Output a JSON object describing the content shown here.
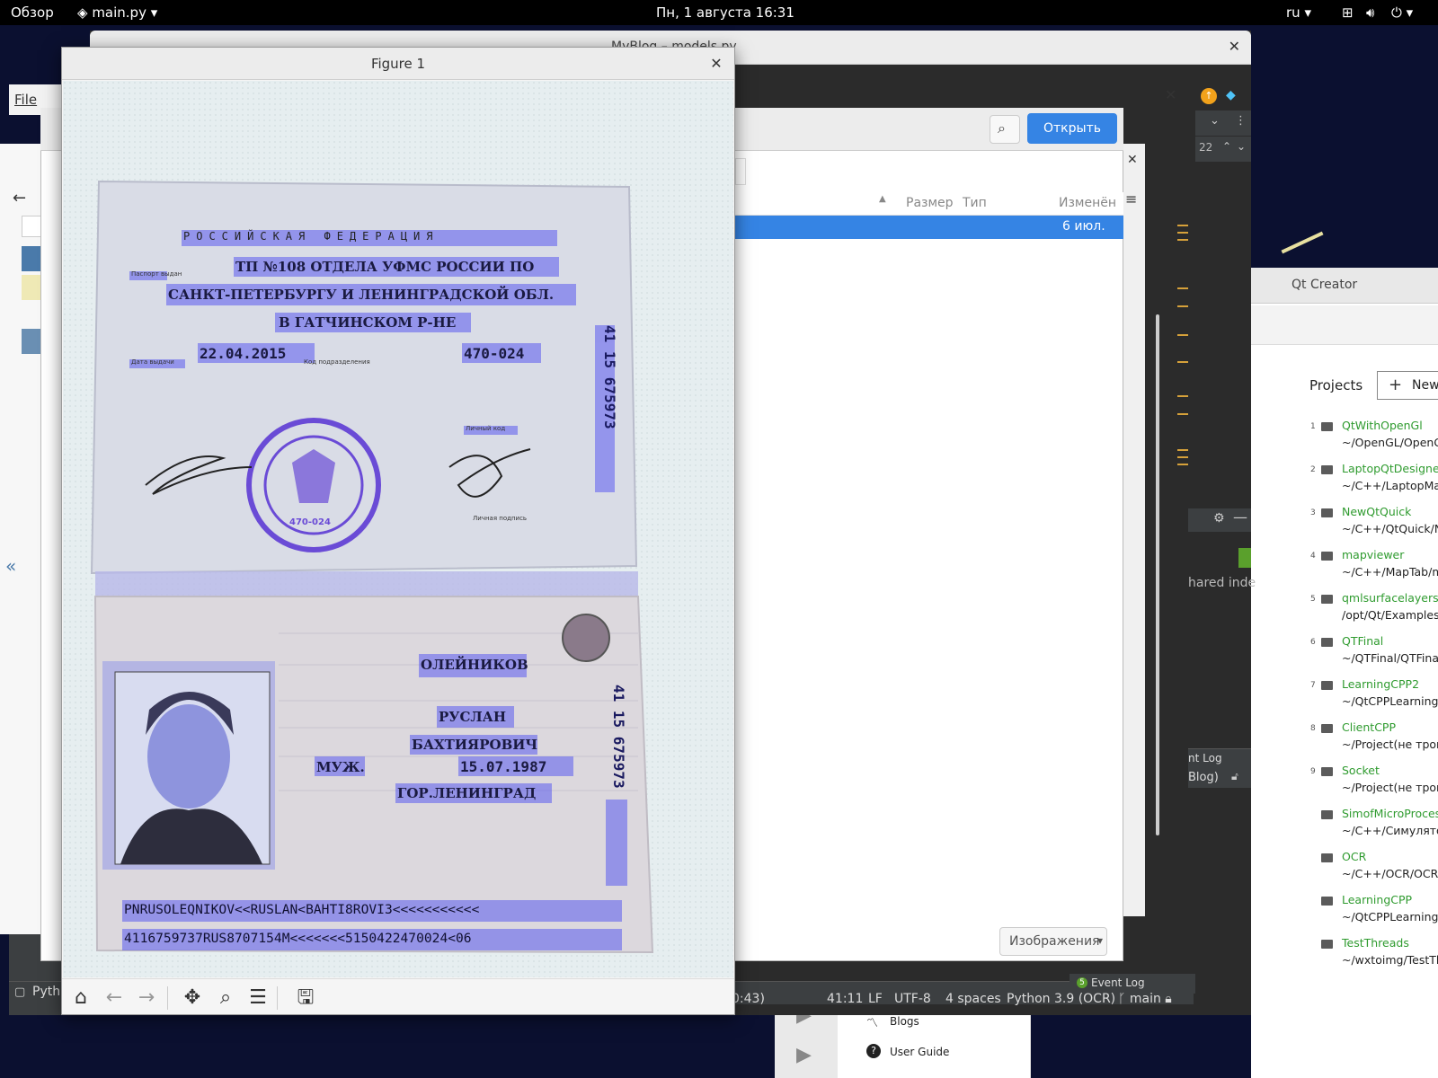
{
  "topbar": {
    "overview": "Обзор",
    "app_menu": "main.py",
    "clock": "Пн, 1 августа  16:31",
    "lang": "ru"
  },
  "back_window": {
    "title": "MyBlog – models.py"
  },
  "file_dialog": {
    "open_label": "Открыть",
    "col_size": "Размер",
    "col_type": "Тип",
    "col_modified": "Изменён",
    "selected_row_modified": "6 июл.",
    "filter_label": "Изображения"
  },
  "ide": {
    "menu_file": "File",
    "status": {
      "time": "0:43)",
      "position": "41:11",
      "line_sep": "LF",
      "encoding": "UTF-8",
      "indent": "4 spaces",
      "interpreter": "Python 3.9 (OCR)",
      "branch": "main",
      "event_log": "Event Log",
      "event_count": "5",
      "python_tab": "Pyth"
    },
    "side_text": "hared inde",
    "event_log_tab": "nt Log",
    "blog_tab": "Blog)",
    "line_number": "22"
  },
  "qt": {
    "title": "Qt Creator",
    "projects_label": "Projects",
    "new_label": "New",
    "projects": [
      {
        "num": "1",
        "name": "QtWithOpenGl",
        "path": "~/OpenGL/OpenGl"
      },
      {
        "num": "2",
        "name": "LaptopQtDesigner",
        "path": "~/C++/LaptopMap"
      },
      {
        "num": "3",
        "name": "NewQtQuick",
        "path": "~/C++/QtQuick/Ne"
      },
      {
        "num": "4",
        "name": "mapviewer",
        "path": "~/C++/MapTab/ma"
      },
      {
        "num": "5",
        "name": "qmlsurfacelayers",
        "path": "/opt/Qt/Examples/"
      },
      {
        "num": "6",
        "name": "QTFinal",
        "path": "~/QTFinal/QTFina"
      },
      {
        "num": "7",
        "name": "LearningCPP2",
        "path": "~/QtCPPLearning/"
      },
      {
        "num": "8",
        "name": "ClientCPP",
        "path": "~/Project(не трога"
      },
      {
        "num": "9",
        "name": "Socket",
        "path": "~/Project(не трога"
      },
      {
        "num": "",
        "name": "SimofMicroProces",
        "path": "~/C++/Симулятор"
      },
      {
        "num": "",
        "name": "OCR",
        "path": "~/C++/OCR/OCR/"
      },
      {
        "num": "",
        "name": "LearningCPP",
        "path": "~/QtCPPLearning/"
      },
      {
        "num": "",
        "name": "TestThreads",
        "path": "~/wxtoimg/TestTh"
      }
    ],
    "bottom_links": [
      {
        "label": "Blogs",
        "icon": "rss-icon"
      },
      {
        "label": "User Guide",
        "icon": "help-icon"
      }
    ]
  },
  "figure": {
    "title": "Figure 1",
    "passport": {
      "header": "РОССИЙСКАЯ   ФЕДЕРАЦИЯ",
      "issuer_1": "ТП №108 ОТДЕЛА УФМС РОССИИ ПО",
      "issuer_2": "САНКТ-ПЕТЕРБУРГУ И ЛЕНИНГРАДСКОЙ ОБЛ.",
      "issuer_3": "В ГАТЧИНСКОМ Р-НЕ",
      "issue_date": "22.04.2015",
      "dept_code": "470-024",
      "serial_top": "41  15  675973",
      "stamp_code": "470-024",
      "surname": "ОЛЕЙНИКОВ",
      "name": "РУСЛАН",
      "patronymic": "БАХТИЯРОВИЧ",
      "sex": "МУЖ.",
      "birth_date": "15.07.1987",
      "birth_place": "ГОР.ЛЕНИНГРАД",
      "serial_bottom": "41  15  675973",
      "mrz_1": "PNRUSOLEQNIKOV<<RUSLAN<BAHTI8ROVI3<<<<<<<<<<<",
      "mrz_2": "4116759737RUS8707154M<<<<<<<5150422470024<06",
      "label_issued": "Паспорт выдан",
      "label_date": "Дата выдачи",
      "label_code": "Код подразделения",
      "label_signature": "Личный код",
      "label_personal": "Личная подпись"
    },
    "toolbar": [
      "home-icon",
      "back-arrow-icon",
      "forward-arrow-icon",
      "pan-icon",
      "zoom-icon",
      "configure-icon",
      "save-icon"
    ]
  }
}
